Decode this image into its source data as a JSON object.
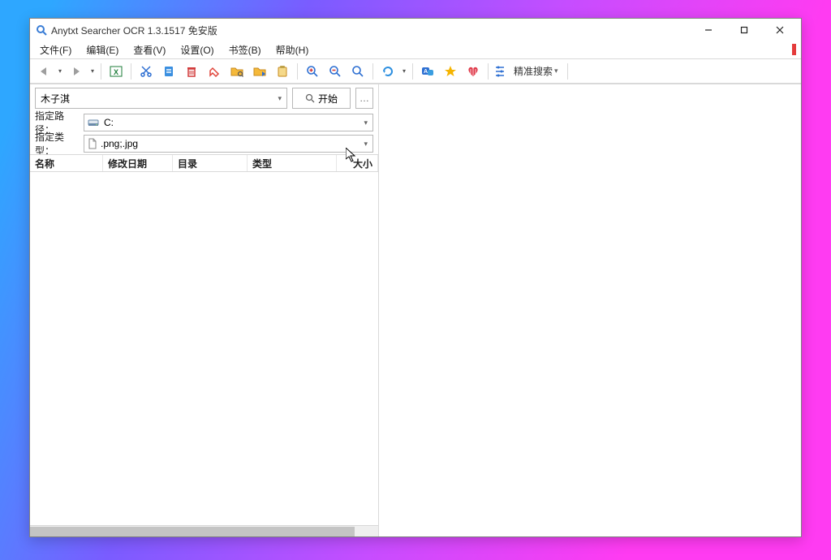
{
  "window": {
    "title": "Anytxt Searcher OCR 1.3.1517 免安版"
  },
  "menu": {
    "file": "文件(F)",
    "edit": "编辑(E)",
    "view": "查看(V)",
    "settings": "设置(O)",
    "bookmark": "书签(B)",
    "help": "帮助(H)"
  },
  "toolbar": {
    "precise": "精准搜索"
  },
  "search": {
    "query": "木子淇",
    "start": "开始",
    "more": "…"
  },
  "fields": {
    "path_label": "指定路径：",
    "path_value": "C:",
    "type_label": "指定类型：",
    "type_value": ".png;.jpg"
  },
  "columns": {
    "name": "名称",
    "date": "修改日期",
    "dir": "目录",
    "type": "类型",
    "size": "大小"
  }
}
